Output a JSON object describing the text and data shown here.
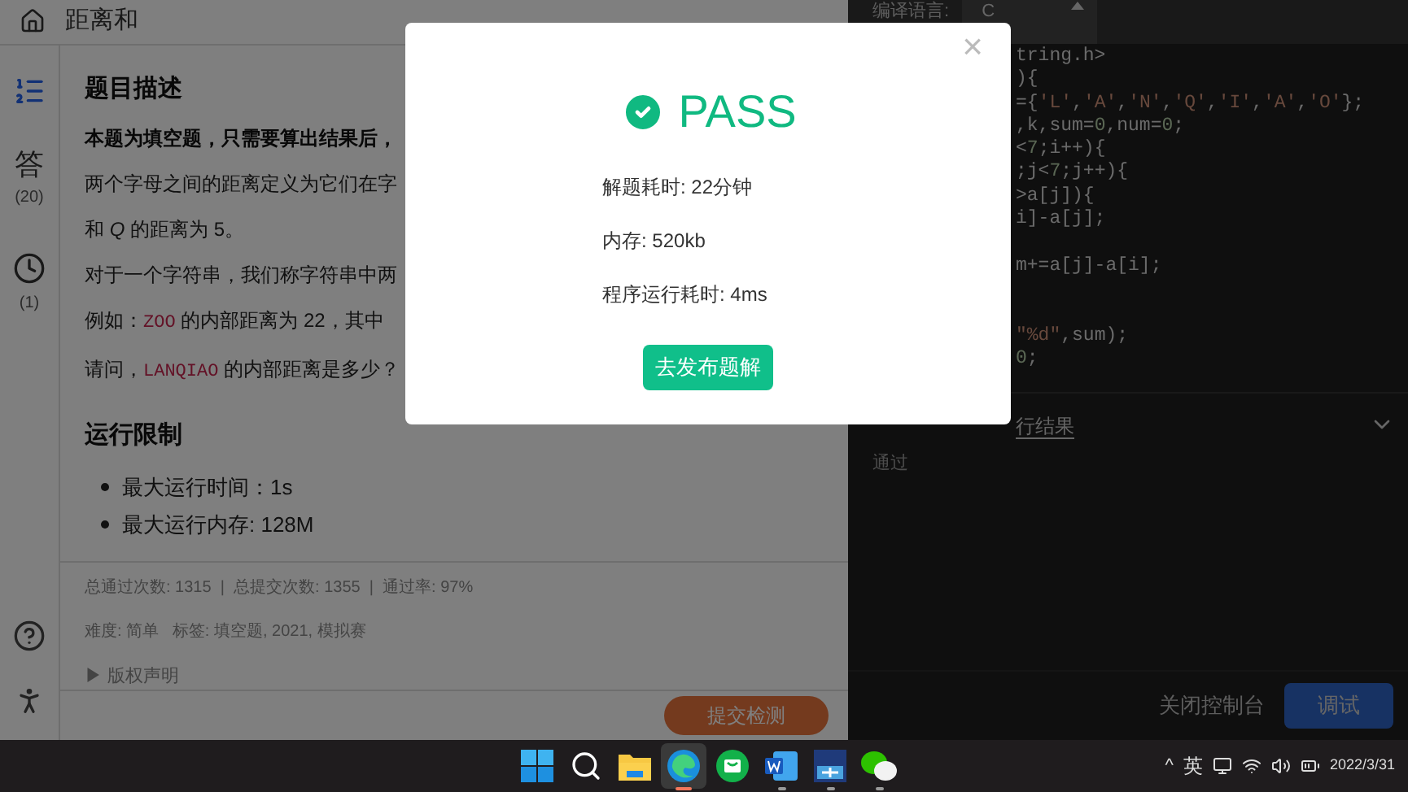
{
  "header": {
    "title": "距离和"
  },
  "sidebar": {
    "items": [
      {
        "kind": "list",
        "selected": true
      },
      {
        "kind": "answer",
        "label": "答",
        "count": "(20)",
        "selected": false
      },
      {
        "kind": "history",
        "count": "(1)",
        "selected": false
      }
    ]
  },
  "problem": {
    "heading": "题目描述",
    "paragraphs": [
      {
        "kind": "bold",
        "text": "本题为填空题，只需要算出结果后，"
      },
      {
        "kind": "plain",
        "text": "两个字母之间的距离定义为它们在字"
      },
      {
        "kind": "plain",
        "text": "和 *Q* 的距离为 5。"
      },
      {
        "kind": "plain",
        "text": "对于一个字符串，我们称字符串中两"
      },
      {
        "kind": "code",
        "before": "例如：",
        "code": "ZOO",
        "after": " 的内部距离为 22，其中"
      },
      {
        "kind": "code",
        "before": "请问，",
        "code": "LANQIAO",
        "after": " 的内部距离是多少？"
      }
    ],
    "limits_heading": "运行限制",
    "limits": [
      "最大运行时间：1s",
      "最大运行内存: 128M"
    ],
    "stats": "总通过次数: 1315  |  总提交次数: 1355  |  通过率: 97%",
    "tags": "难度: 简单   标签: 填空题, 2021, 模拟赛",
    "copyright": "▶ 版权声明",
    "submit": "提交检测"
  },
  "editor": {
    "language_label": "编译语言:",
    "language": "C",
    "lines": [
      {
        "kind": "code",
        "tokens": [
          {
            "kind": "plain",
            "text": "tring.h>"
          }
        ]
      },
      {
        "kind": "code",
        "tokens": [
          {
            "kind": "plain",
            "text": "){"
          }
        ]
      },
      {
        "kind": "code",
        "tokens": [
          {
            "kind": "plain",
            "text": "={"
          },
          {
            "kind": "string",
            "text": "'L'"
          },
          {
            "kind": "plain",
            "text": ","
          },
          {
            "kind": "string",
            "text": "'A'"
          },
          {
            "kind": "plain",
            "text": ","
          },
          {
            "kind": "string",
            "text": "'N'"
          },
          {
            "kind": "plain",
            "text": ","
          },
          {
            "kind": "string",
            "text": "'Q'"
          },
          {
            "kind": "plain",
            "text": ","
          },
          {
            "kind": "string",
            "text": "'I'"
          },
          {
            "kind": "plain",
            "text": ","
          },
          {
            "kind": "string",
            "text": "'A'"
          },
          {
            "kind": "plain",
            "text": ","
          },
          {
            "kind": "string",
            "text": "'O'"
          },
          {
            "kind": "plain",
            "text": "};"
          }
        ]
      },
      {
        "kind": "code",
        "tokens": [
          {
            "kind": "plain",
            "text": ",k,sum="
          },
          {
            "kind": "number",
            "text": "0"
          },
          {
            "kind": "plain",
            "text": ",num="
          },
          {
            "kind": "number",
            "text": "0"
          },
          {
            "kind": "plain",
            "text": ";"
          }
        ]
      },
      {
        "kind": "code",
        "tokens": [
          {
            "kind": "plain",
            "text": "<"
          },
          {
            "kind": "number",
            "text": "7"
          },
          {
            "kind": "plain",
            "text": ";i++){"
          }
        ]
      },
      {
        "kind": "code",
        "tokens": [
          {
            "kind": "plain",
            "text": ";j<"
          },
          {
            "kind": "number",
            "text": "7"
          },
          {
            "kind": "plain",
            "text": ";j++){"
          }
        ]
      },
      {
        "kind": "code",
        "tokens": [
          {
            "kind": "plain",
            "text": ">a[j]){"
          }
        ]
      },
      {
        "kind": "code",
        "tokens": [
          {
            "kind": "plain",
            "text": "i]-a[j];"
          }
        ]
      },
      {
        "kind": "blank"
      },
      {
        "kind": "code",
        "tokens": [
          {
            "kind": "plain",
            "text": "m+=a[j]-a[i];"
          }
        ]
      },
      {
        "kind": "blank"
      },
      {
        "kind": "blank"
      },
      {
        "kind": "code",
        "tokens": [
          {
            "kind": "string",
            "text": "\"%d\""
          },
          {
            "kind": "plain",
            "text": ",sum);"
          }
        ]
      },
      {
        "kind": "code",
        "tokens": [
          {
            "kind": "number",
            "text": "0"
          },
          {
            "kind": "plain",
            "text": ";"
          }
        ]
      }
    ]
  },
  "console": {
    "tab": "行结果",
    "output": "通过",
    "close": "关闭控制台",
    "debug": "调试"
  },
  "dialog": {
    "close": "×",
    "result": "PASS",
    "stats": [
      "解题耗时: 22分钟",
      "内存: 520kb",
      "程序运行耗时: 4ms"
    ],
    "publish": "去发布题解"
  },
  "taskbar": {
    "apps": [
      {
        "kind": "start",
        "selected": false,
        "running": false
      },
      {
        "kind": "search",
        "selected": false,
        "running": false
      },
      {
        "kind": "folder",
        "selected": false,
        "running": false
      },
      {
        "kind": "browser",
        "selected": true,
        "running": true
      },
      {
        "kind": "store",
        "selected": false,
        "running": false
      },
      {
        "kind": "word",
        "selected": false,
        "running": true
      },
      {
        "kind": "ide",
        "selected": false,
        "running": true
      },
      {
        "kind": "chat",
        "selected": false,
        "running": true
      }
    ],
    "tray": {
      "chevron": "^",
      "ime": "英",
      "date": "2022/3/31"
    }
  }
}
